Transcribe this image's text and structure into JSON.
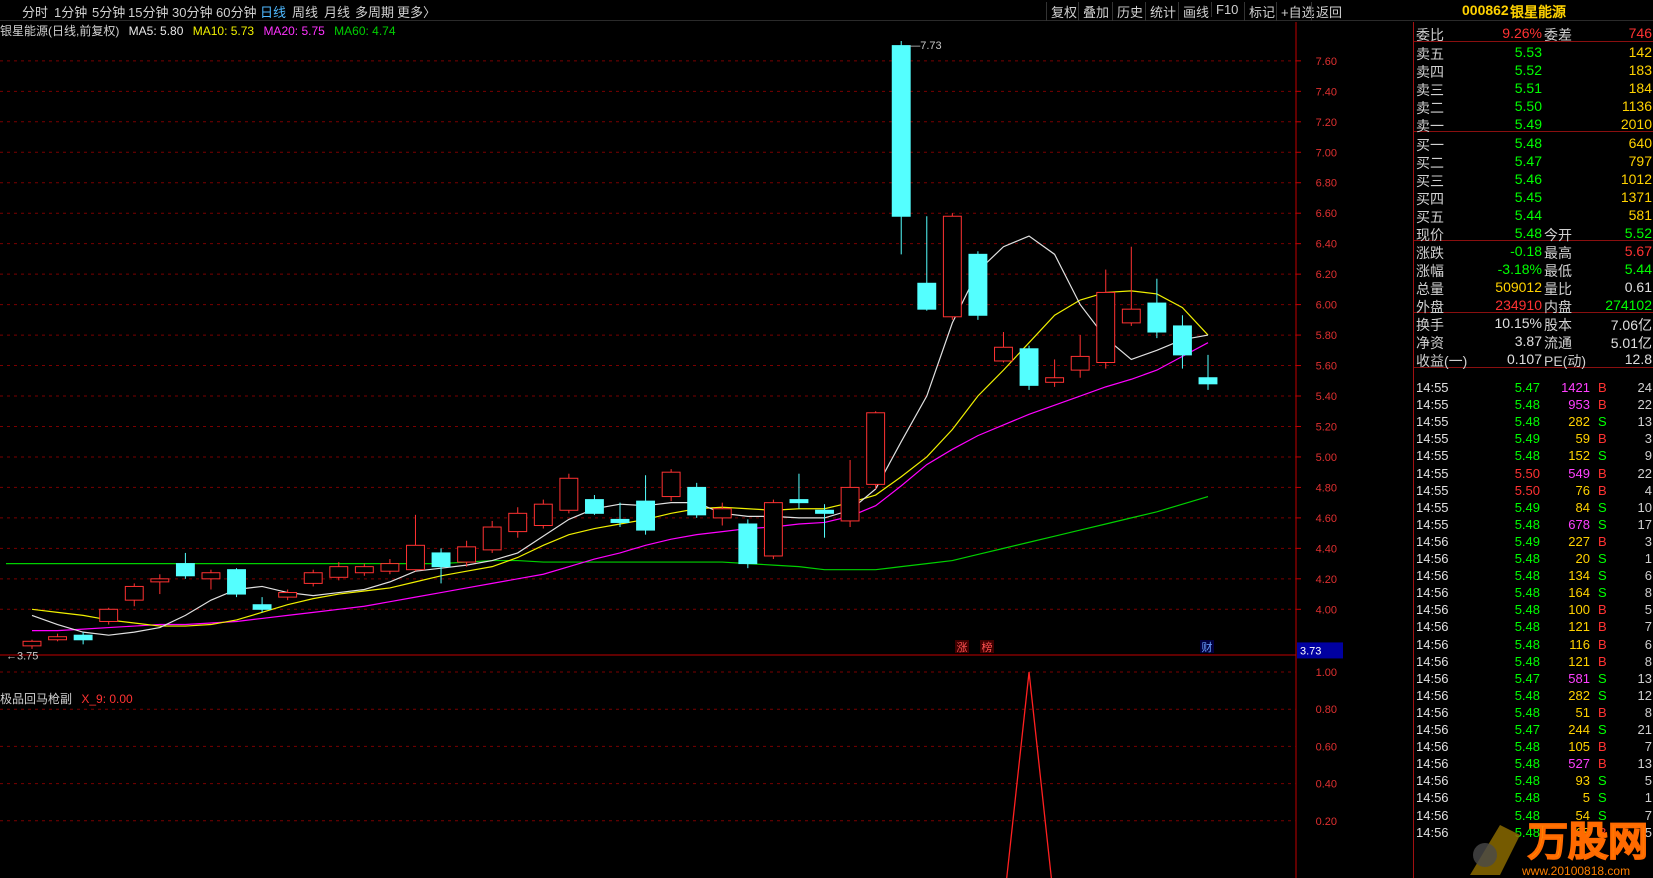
{
  "toolbar": {
    "periods": [
      "分时",
      "1分钟",
      "5分钟",
      "15分钟",
      "30分钟",
      "60分钟",
      "日线",
      "周线",
      "月线",
      "多周期",
      "更多〉"
    ],
    "active_period": "日线",
    "tools": [
      "复权",
      "叠加",
      "历史",
      "统计",
      "画线",
      "F10",
      "标记",
      "+自选",
      "返回"
    ]
  },
  "stock": {
    "code": "000862",
    "name": "银星能源"
  },
  "legend": {
    "title": "银星能源(日线,前复权)",
    "ma5": "MA5: 5.80",
    "ma10": "MA10: 5.73",
    "ma20": "MA20: 5.75",
    "ma60": "MA60: 4.74"
  },
  "indicator": {
    "name": "极品回马枪副",
    "value": "X_9: 0.00"
  },
  "colors": {
    "up": "#ff3232",
    "down": "#54ffff",
    "ma5": "#e0e0e0",
    "ma10": "#f0f000",
    "ma20": "#ff00ff",
    "ma60": "#00d000",
    "grid": "#7a0000",
    "axis": "#c00000"
  },
  "chart_data": {
    "type": "candlestick",
    "price_axis": {
      "ticks": [
        "7.60",
        "7.40",
        "7.20",
        "7.00",
        "6.80",
        "6.60",
        "6.40",
        "6.20",
        "6.00",
        "5.80",
        "5.60",
        "5.40",
        "5.20",
        "5.00",
        "4.80",
        "4.60",
        "4.40",
        "4.20",
        "4.00"
      ],
      "ylim": [
        3.7,
        7.75
      ],
      "current_label": "3.73"
    },
    "annotations": {
      "high_label": "7.73",
      "low_label": "3.75",
      "event_markers": [
        "涨",
        "榜",
        "财"
      ]
    },
    "candles": [
      {
        "o": 3.76,
        "c": 3.79,
        "h": 3.8,
        "l": 3.74
      },
      {
        "o": 3.8,
        "c": 3.82,
        "h": 3.84,
        "l": 3.79
      },
      {
        "o": 3.83,
        "c": 3.8,
        "h": 3.85,
        "l": 3.77
      },
      {
        "o": 3.92,
        "c": 4.0,
        "h": 4.01,
        "l": 3.9
      },
      {
        "o": 4.06,
        "c": 4.15,
        "h": 4.17,
        "l": 4.02
      },
      {
        "o": 4.18,
        "c": 4.2,
        "h": 4.23,
        "l": 4.1
      },
      {
        "o": 4.3,
        "c": 4.22,
        "h": 4.37,
        "l": 4.2
      },
      {
        "o": 4.2,
        "c": 4.24,
        "h": 4.26,
        "l": 4.13
      },
      {
        "o": 4.26,
        "c": 4.1,
        "h": 4.27,
        "l": 4.08
      },
      {
        "o": 4.03,
        "c": 4.0,
        "h": 4.08,
        "l": 3.98
      },
      {
        "o": 4.08,
        "c": 4.11,
        "h": 4.13,
        "l": 4.06
      },
      {
        "o": 4.17,
        "c": 4.24,
        "h": 4.26,
        "l": 4.15
      },
      {
        "o": 4.21,
        "c": 4.28,
        "h": 4.31,
        "l": 4.19
      },
      {
        "o": 4.24,
        "c": 4.28,
        "h": 4.3,
        "l": 4.22
      },
      {
        "o": 4.25,
        "c": 4.3,
        "h": 4.33,
        "l": 4.23
      },
      {
        "o": 4.26,
        "c": 4.42,
        "h": 4.62,
        "l": 4.25
      },
      {
        "o": 4.37,
        "c": 4.28,
        "h": 4.4,
        "l": 4.17
      },
      {
        "o": 4.31,
        "c": 4.41,
        "h": 4.45,
        "l": 4.28
      },
      {
        "o": 4.39,
        "c": 4.54,
        "h": 4.58,
        "l": 4.37
      },
      {
        "o": 4.51,
        "c": 4.63,
        "h": 4.67,
        "l": 4.47
      },
      {
        "o": 4.55,
        "c": 4.69,
        "h": 4.72,
        "l": 4.53
      },
      {
        "o": 4.65,
        "c": 4.86,
        "h": 4.89,
        "l": 4.63
      },
      {
        "o": 4.72,
        "c": 4.63,
        "h": 4.75,
        "l": 4.62
      },
      {
        "o": 4.59,
        "c": 4.57,
        "h": 4.7,
        "l": 4.54
      },
      {
        "o": 4.71,
        "c": 4.52,
        "h": 4.88,
        "l": 4.49
      },
      {
        "o": 4.74,
        "c": 4.9,
        "h": 4.92,
        "l": 4.71
      },
      {
        "o": 4.8,
        "c": 4.62,
        "h": 4.83,
        "l": 4.6
      },
      {
        "o": 4.6,
        "c": 4.66,
        "h": 4.7,
        "l": 4.55
      },
      {
        "o": 4.56,
        "c": 4.3,
        "h": 4.59,
        "l": 4.27
      },
      {
        "o": 4.35,
        "c": 4.7,
        "h": 4.72,
        "l": 4.33
      },
      {
        "o": 4.72,
        "c": 4.7,
        "h": 4.89,
        "l": 4.66
      },
      {
        "o": 4.65,
        "c": 4.63,
        "h": 4.69,
        "l": 4.47
      },
      {
        "o": 4.58,
        "c": 4.8,
        "h": 4.98,
        "l": 4.54
      },
      {
        "o": 4.82,
        "c": 5.29,
        "h": 5.3,
        "l": 4.79
      },
      {
        "o": 7.7,
        "c": 6.58,
        "h": 7.73,
        "l": 6.33
      },
      {
        "o": 6.14,
        "c": 5.97,
        "h": 6.58,
        "l": 5.96
      },
      {
        "o": 5.92,
        "c": 6.58,
        "h": 6.6,
        "l": 5.9
      },
      {
        "o": 6.33,
        "c": 5.93,
        "h": 6.35,
        "l": 5.9
      },
      {
        "o": 5.63,
        "c": 5.72,
        "h": 5.82,
        "l": 5.62
      },
      {
        "o": 5.71,
        "c": 5.47,
        "h": 5.73,
        "l": 5.44
      },
      {
        "o": 5.49,
        "c": 5.52,
        "h": 5.64,
        "l": 5.46
      },
      {
        "o": 5.57,
        "c": 5.66,
        "h": 5.8,
        "l": 5.52
      },
      {
        "o": 5.62,
        "c": 6.08,
        "h": 6.23,
        "l": 5.58
      },
      {
        "o": 5.88,
        "c": 5.97,
        "h": 6.38,
        "l": 5.86
      },
      {
        "o": 6.01,
        "c": 5.82,
        "h": 6.17,
        "l": 5.78
      },
      {
        "o": 5.86,
        "c": 5.67,
        "h": 5.93,
        "l": 5.58
      },
      {
        "o": 5.52,
        "c": 5.48,
        "h": 5.67,
        "l": 5.44
      }
    ],
    "ma5": [
      3.96,
      3.9,
      3.85,
      3.83,
      3.85,
      3.88,
      3.96,
      4.06,
      4.13,
      4.15,
      4.11,
      4.09,
      4.11,
      4.13,
      4.18,
      4.25,
      4.27,
      4.29,
      4.32,
      4.37,
      4.48,
      4.59,
      4.66,
      4.69,
      4.68,
      4.7,
      4.7,
      4.63,
      4.61,
      4.61,
      4.6,
      4.6,
      4.65,
      4.79,
      5.1,
      5.4,
      5.88,
      6.22,
      6.38,
      6.45,
      6.33,
      6.0,
      5.78,
      5.64,
      5.7,
      5.77,
      5.8
    ],
    "ma10": [
      4.0,
      3.98,
      3.96,
      3.93,
      3.91,
      3.89,
      3.89,
      3.9,
      3.93,
      3.98,
      4.03,
      4.07,
      4.1,
      4.12,
      4.14,
      4.18,
      4.22,
      4.25,
      4.28,
      4.34,
      4.42,
      4.49,
      4.53,
      4.56,
      4.59,
      4.63,
      4.66,
      4.67,
      4.66,
      4.65,
      4.66,
      4.66,
      4.7,
      4.75,
      4.87,
      5.0,
      5.18,
      5.4,
      5.57,
      5.75,
      5.93,
      6.03,
      6.08,
      6.09,
      6.07,
      5.98,
      5.8
    ],
    "ma20": [
      3.86,
      3.86,
      3.87,
      3.88,
      3.89,
      3.9,
      3.9,
      3.91,
      3.92,
      3.94,
      3.96,
      3.98,
      4.0,
      4.02,
      4.05,
      4.08,
      4.11,
      4.14,
      4.17,
      4.2,
      4.23,
      4.28,
      4.33,
      4.37,
      4.42,
      4.46,
      4.49,
      4.51,
      4.53,
      4.54,
      4.56,
      4.57,
      4.61,
      4.68,
      4.81,
      4.95,
      5.05,
      5.14,
      5.21,
      5.28,
      5.34,
      5.4,
      5.46,
      5.51,
      5.57,
      5.66,
      5.75
    ],
    "ma60": [
      4.3,
      4.3,
      4.3,
      4.3,
      4.3,
      4.3,
      4.3,
      4.3,
      4.3,
      4.3,
      4.3,
      4.3,
      4.3,
      4.3,
      4.3,
      4.3,
      4.3,
      4.31,
      4.32,
      4.32,
      4.31,
      4.31,
      4.31,
      4.31,
      4.31,
      4.31,
      4.31,
      4.31,
      4.3,
      4.29,
      4.28,
      4.26,
      4.26,
      4.26,
      4.28,
      4.3,
      4.32,
      4.36,
      4.4,
      4.44,
      4.48,
      4.52,
      4.56,
      4.6,
      4.64,
      4.69,
      4.74
    ],
    "indicator_series": {
      "name": "X_9",
      "values": [
        0,
        0,
        0,
        0,
        0,
        0,
        0,
        0,
        0,
        0,
        0,
        0,
        0,
        0,
        0,
        0,
        0,
        0,
        0,
        0,
        0,
        0,
        0,
        0,
        0,
        0,
        0,
        0,
        0,
        0,
        0,
        0,
        0,
        0,
        0,
        0,
        0,
        0,
        0,
        1,
        0,
        0,
        0,
        0,
        0,
        0,
        0,
        0
      ],
      "axis_ticks": [
        "1.00",
        "0.80",
        "0.60",
        "0.40",
        "0.20"
      ],
      "ylim": [
        0,
        1.0
      ]
    }
  },
  "quote": {
    "rows": [
      {
        "l": "委比",
        "v": "9.26%",
        "l2": "委差",
        "v2": "746"
      },
      {
        "l": "卖五",
        "v": "5.53",
        "v2": "142"
      },
      {
        "l": "卖四",
        "v": "5.52",
        "v2": "183"
      },
      {
        "l": "卖三",
        "v": "5.51",
        "v2": "184"
      },
      {
        "l": "卖二",
        "v": "5.50",
        "v2": "1136"
      },
      {
        "l": "卖一",
        "v": "5.49",
        "v2": "2010"
      },
      {
        "l": "买一",
        "v": "5.48",
        "v2": "640"
      },
      {
        "l": "买二",
        "v": "5.47",
        "v2": "797"
      },
      {
        "l": "买三",
        "v": "5.46",
        "v2": "1012"
      },
      {
        "l": "买四",
        "v": "5.45",
        "v2": "1371"
      },
      {
        "l": "买五",
        "v": "5.44",
        "v2": "581"
      },
      {
        "l": "现价",
        "v": "5.48",
        "l2": "今开",
        "v2": "5.52"
      },
      {
        "l": "涨跌",
        "v": "-0.18",
        "l2": "最高",
        "v2": "5.67"
      },
      {
        "l": "涨幅",
        "v": "-3.18%",
        "l2": "最低",
        "v2": "5.44"
      },
      {
        "l": "总量",
        "v": "509012",
        "l2": "量比",
        "v2": "0.61"
      },
      {
        "l": "外盘",
        "v": "234910",
        "l2": "内盘",
        "v2": "274102"
      },
      {
        "l": "换手",
        "v": "10.15%",
        "l2": "股本",
        "v2": "7.06亿"
      },
      {
        "l": "净资",
        "v": "3.87",
        "l2": "流通",
        "v2": "5.01亿"
      },
      {
        "l": "收益(一)",
        "v": "0.107",
        "l2": "PE(动)",
        "v2": "12.8"
      }
    ]
  },
  "ticks": [
    {
      "t": "14:55",
      "p": "5.47",
      "v": "1421",
      "s": "B",
      "n": "24"
    },
    {
      "t": "14:55",
      "p": "5.48",
      "v": "953",
      "s": "B",
      "n": "22"
    },
    {
      "t": "14:55",
      "p": "5.48",
      "v": "282",
      "s": "S",
      "n": "13"
    },
    {
      "t": "14:55",
      "p": "5.49",
      "v": "59",
      "s": "B",
      "n": "3"
    },
    {
      "t": "14:55",
      "p": "5.48",
      "v": "152",
      "s": "S",
      "n": "9"
    },
    {
      "t": "14:55",
      "p": "5.50",
      "v": "549",
      "s": "B",
      "n": "22"
    },
    {
      "t": "14:55",
      "p": "5.50",
      "v": "76",
      "s": "B",
      "n": "4"
    },
    {
      "t": "14:55",
      "p": "5.49",
      "v": "84",
      "s": "S",
      "n": "10"
    },
    {
      "t": "14:55",
      "p": "5.48",
      "v": "678",
      "s": "S",
      "n": "17"
    },
    {
      "t": "14:56",
      "p": "5.49",
      "v": "227",
      "s": "B",
      "n": "3"
    },
    {
      "t": "14:56",
      "p": "5.48",
      "v": "20",
      "s": "S",
      "n": "1"
    },
    {
      "t": "14:56",
      "p": "5.48",
      "v": "134",
      "s": "S",
      "n": "6"
    },
    {
      "t": "14:56",
      "p": "5.48",
      "v": "164",
      "s": "S",
      "n": "8"
    },
    {
      "t": "14:56",
      "p": "5.48",
      "v": "100",
      "s": "B",
      "n": "5"
    },
    {
      "t": "14:56",
      "p": "5.48",
      "v": "121",
      "s": "B",
      "n": "7"
    },
    {
      "t": "14:56",
      "p": "5.48",
      "v": "116",
      "s": "B",
      "n": "6"
    },
    {
      "t": "14:56",
      "p": "5.48",
      "v": "121",
      "s": "B",
      "n": "8"
    },
    {
      "t": "14:56",
      "p": "5.47",
      "v": "581",
      "s": "S",
      "n": "13"
    },
    {
      "t": "14:56",
      "p": "5.48",
      "v": "282",
      "s": "S",
      "n": "12"
    },
    {
      "t": "14:56",
      "p": "5.48",
      "v": "51",
      "s": "B",
      "n": "8"
    },
    {
      "t": "14:56",
      "p": "5.47",
      "v": "244",
      "s": "S",
      "n": "21"
    },
    {
      "t": "14:56",
      "p": "5.48",
      "v": "105",
      "s": "B",
      "n": "7"
    },
    {
      "t": "14:56",
      "p": "5.48",
      "v": "527",
      "s": "B",
      "n": "13"
    },
    {
      "t": "14:56",
      "p": "5.48",
      "v": "93",
      "s": "S",
      "n": "5"
    },
    {
      "t": "14:56",
      "p": "5.48",
      "v": "5",
      "s": "S",
      "n": "1"
    },
    {
      "t": "14:56",
      "p": "5.48",
      "v": "54",
      "s": "S",
      "n": "7"
    },
    {
      "t": "14:56",
      "p": "5.48",
      "v": "68",
      "s": "B",
      "n": "5"
    }
  ],
  "watermark": {
    "text": "万股网",
    "url": "www.20100818.com"
  }
}
